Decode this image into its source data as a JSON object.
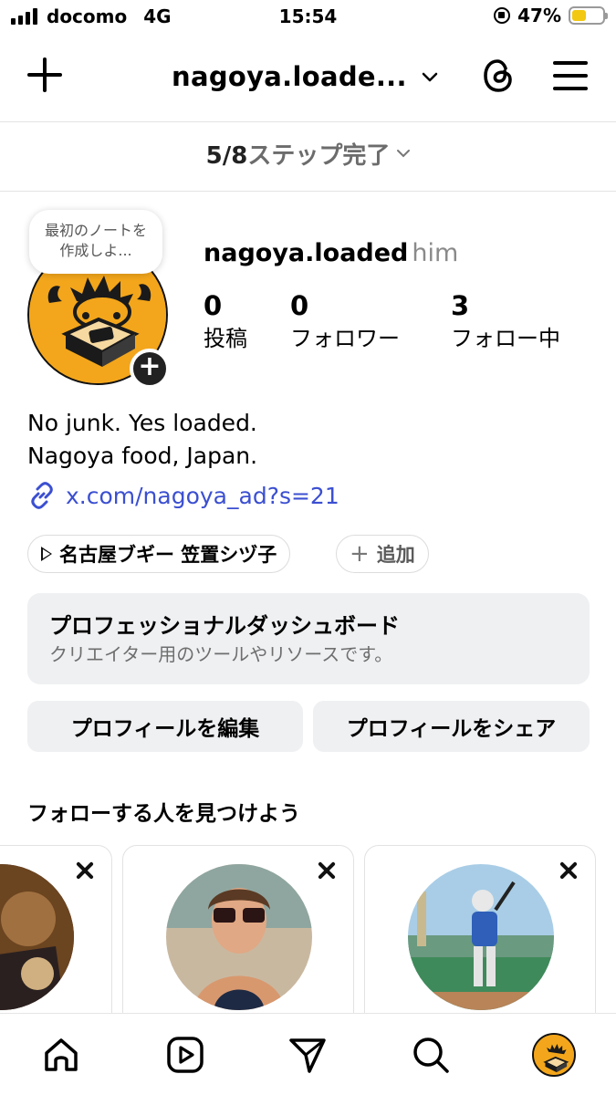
{
  "status_bar": {
    "carrier": "docomo",
    "network": "4G",
    "time": "15:54",
    "battery_percent": "47%",
    "battery_level": 0.47,
    "battery_color": "#f2c811"
  },
  "top_nav": {
    "title": "nagoya.loade...",
    "new_post_icon": "plus-icon",
    "switch_account_icon": "chevron-down-icon",
    "threads_icon": "threads-icon",
    "menu_icon": "hamburger-menu-icon"
  },
  "steps": {
    "count": "5/8",
    "label": "ステップ完了"
  },
  "profile": {
    "note_bubble": "最初のノートを作成しよ...",
    "username": "nagoya.loaded",
    "pronoun": "him",
    "stats": [
      {
        "value": "0",
        "label": "投稿"
      },
      {
        "value": "0",
        "label": "フォロワー"
      },
      {
        "value": "3",
        "label": "フォロー中"
      }
    ],
    "bio_line1": "No junk. Yes loaded.",
    "bio_line2": "Nagoya food, Japan.",
    "link": "x.com/nagoya_ad?s=21",
    "music_chip": "名古屋ブギー 笠置シヅ子",
    "add_chip": "追加",
    "accent_color": "#f3a61b"
  },
  "dashboard": {
    "title": "プロフェッショナルダッシュボード",
    "subtitle": "クリエイター用のツールやリソースです。"
  },
  "actions": {
    "edit_profile": "プロフィールを編集",
    "share_profile": "プロフィールをシェア"
  },
  "suggestions": {
    "heading": "フォローする人を見つけよう"
  },
  "tab_bar": {
    "items": [
      "home-icon",
      "reels-icon",
      "messages-icon",
      "search-icon",
      "profile-avatar"
    ]
  }
}
